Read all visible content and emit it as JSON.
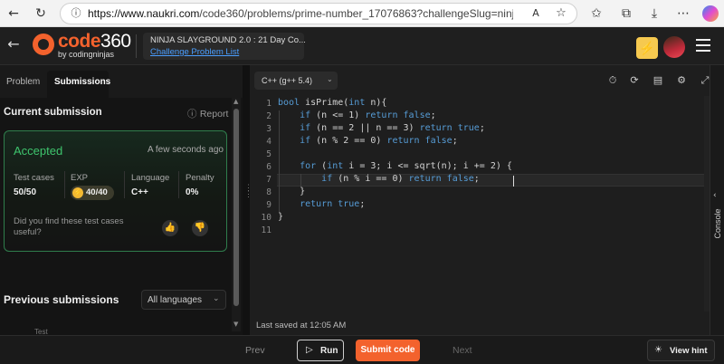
{
  "browser": {
    "url_host": "https://www.naukri.com",
    "url_path": "/code360/problems/prime-number_17076863?challengeSlug=ninja-slaygro..."
  },
  "header": {
    "logo_word": "code",
    "logo_num": "360",
    "logo_sub": "by codingninjas",
    "event_title": "NINJA SLAYGROUND 2.0 : 21 Day Co...",
    "event_link": "Challenge Problem List"
  },
  "tabs": [
    {
      "label": "Problem"
    },
    {
      "label": "Submissions"
    }
  ],
  "current_submission": {
    "title": "Current submission",
    "report_label": "Report",
    "status": "Accepted",
    "time_ago": "A few seconds ago",
    "stats": [
      {
        "label": "Test cases",
        "value": "50/50"
      },
      {
        "label": "EXP",
        "value": "40/40"
      },
      {
        "label": "Language",
        "value": "C++"
      },
      {
        "label": "Penalty",
        "value": "0%"
      }
    ],
    "feedback_question": "Did you find these test cases useful?"
  },
  "previous_submissions": {
    "title": "Previous submissions",
    "filter_value": "All languages",
    "peek_header": "Test"
  },
  "editor": {
    "compiler": "C++ (g++ 5.4)",
    "last_saved": "Last saved at 12:05 AM",
    "lines": [
      "bool isPrime(int n){",
      "    if (n <= 1) return false;",
      "    if (n == 2 || n == 3) return true;",
      "    if (n % 2 == 0) return false;",
      "",
      "    for (int i = 3; i <= sqrt(n); i += 2) {",
      "        if (n % i == 0) return false;",
      "    }",
      "    return true;",
      "}",
      ""
    ]
  },
  "console": {
    "label": "Console"
  },
  "bottom_bar": {
    "prev_label": "Prev",
    "run_label": "Run",
    "submit_label": "Submit code",
    "next_label": "Next",
    "hint_label": "View hint"
  },
  "colors": {
    "brand_orange": "#f3622d",
    "accepted_green": "#3ec46d",
    "link_blue": "#4a9eff",
    "keyword_blue": "#569cd6"
  },
  "icons": [
    "back-arrow-icon",
    "forward-arrow-icon",
    "refresh-icon",
    "info-icon",
    "read-aloud-icon",
    "star-icon",
    "favorites-icon",
    "collections-icon",
    "download-icon",
    "copilot-icon",
    "bolt-icon",
    "menu-icon",
    "timer-icon",
    "refresh-code-icon",
    "bookmark-icon",
    "settings-icon",
    "fullscreen-icon",
    "thumbs-up-icon",
    "thumbs-down-icon",
    "play-icon",
    "lightbulb-icon"
  ]
}
